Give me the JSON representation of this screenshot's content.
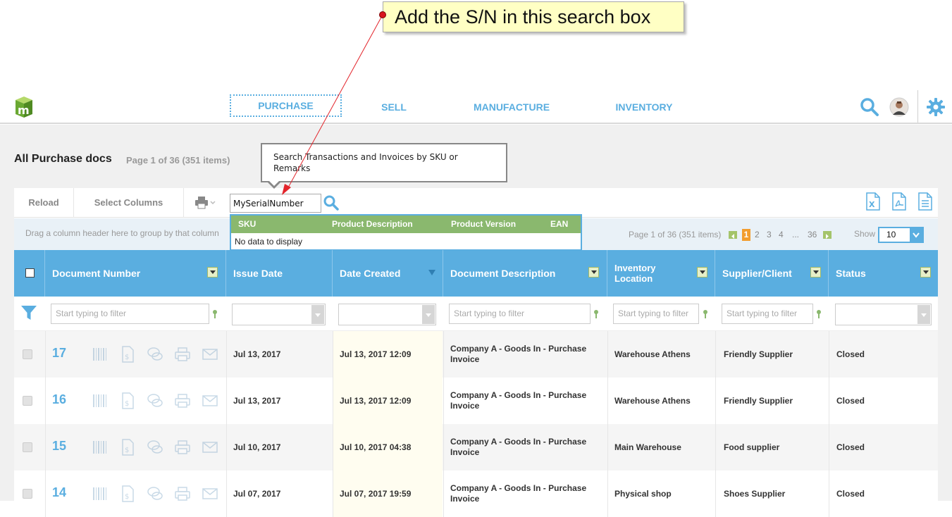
{
  "annotation": {
    "text": "Add the S/N in this search box"
  },
  "nav": {
    "items": [
      "PURCHASE",
      "SELL",
      "MANUFACTURE",
      "INVENTORY"
    ],
    "active": "PURCHASE"
  },
  "page": {
    "title": "All Purchase docs",
    "info": "Page 1 of 36 (351 items)"
  },
  "tooltip": {
    "text": "Search Transactions and Invoices by SKU or Remarks"
  },
  "toolbar": {
    "reload": "Reload",
    "select_columns": "Select Columns",
    "search_value": "MySerialNumber"
  },
  "dropdown": {
    "columns": [
      "SKU",
      "Product Description",
      "Product Version",
      "EAN"
    ],
    "empty": "No data to display"
  },
  "groupbar": {
    "hint": "Drag a column header here to group by that column",
    "pager_info": "Page 1 of 36 (351 items)",
    "pages": [
      "1",
      "2",
      "3",
      "4",
      "...",
      "36"
    ],
    "current_page": "1",
    "show_label": "Show",
    "show_value": "10"
  },
  "columns": {
    "document_number": "Document Number",
    "issue_date": "Issue Date",
    "date_created": "Date Created",
    "document_description": "Document Description",
    "inventory_location": "Inventory Location",
    "supplier_client": "Supplier/Client",
    "status": "Status"
  },
  "filters": {
    "placeholder": "Start typing to filter"
  },
  "rows": [
    {
      "number": "17",
      "issue_date": "Jul 13, 2017",
      "created": "Jul 13, 2017 12:09",
      "desc1": "Company A - Goods In - Purchase",
      "desc2": "Invoice",
      "location": "Warehouse Athens",
      "supplier": "Friendly Supplier",
      "status": "Closed"
    },
    {
      "number": "16",
      "issue_date": "Jul 13, 2017",
      "created": "Jul 13, 2017 12:09",
      "desc1": "Company A - Goods In - Purchase",
      "desc2": "Invoice",
      "location": "Warehouse Athens",
      "supplier": "Friendly Supplier",
      "status": "Closed"
    },
    {
      "number": "15",
      "issue_date": "Jul 10, 2017",
      "created": "Jul 10, 2017 04:38",
      "desc1": "Company A - Goods In - Purchase",
      "desc2": "Invoice",
      "location": "Main Warehouse",
      "supplier": "Food supplier",
      "status": "Closed"
    },
    {
      "number": "14",
      "issue_date": "Jul 07, 2017",
      "created": "Jul 07, 2017 19:59",
      "desc1": "Company A - Goods In - Purchase",
      "desc2": "Invoice",
      "location": "Physical shop",
      "supplier": "Shoes Supplier",
      "status": "Closed"
    }
  ],
  "colors": {
    "accent": "#5aaee0",
    "green": "#8ab86e",
    "orange": "#f29d2f"
  }
}
